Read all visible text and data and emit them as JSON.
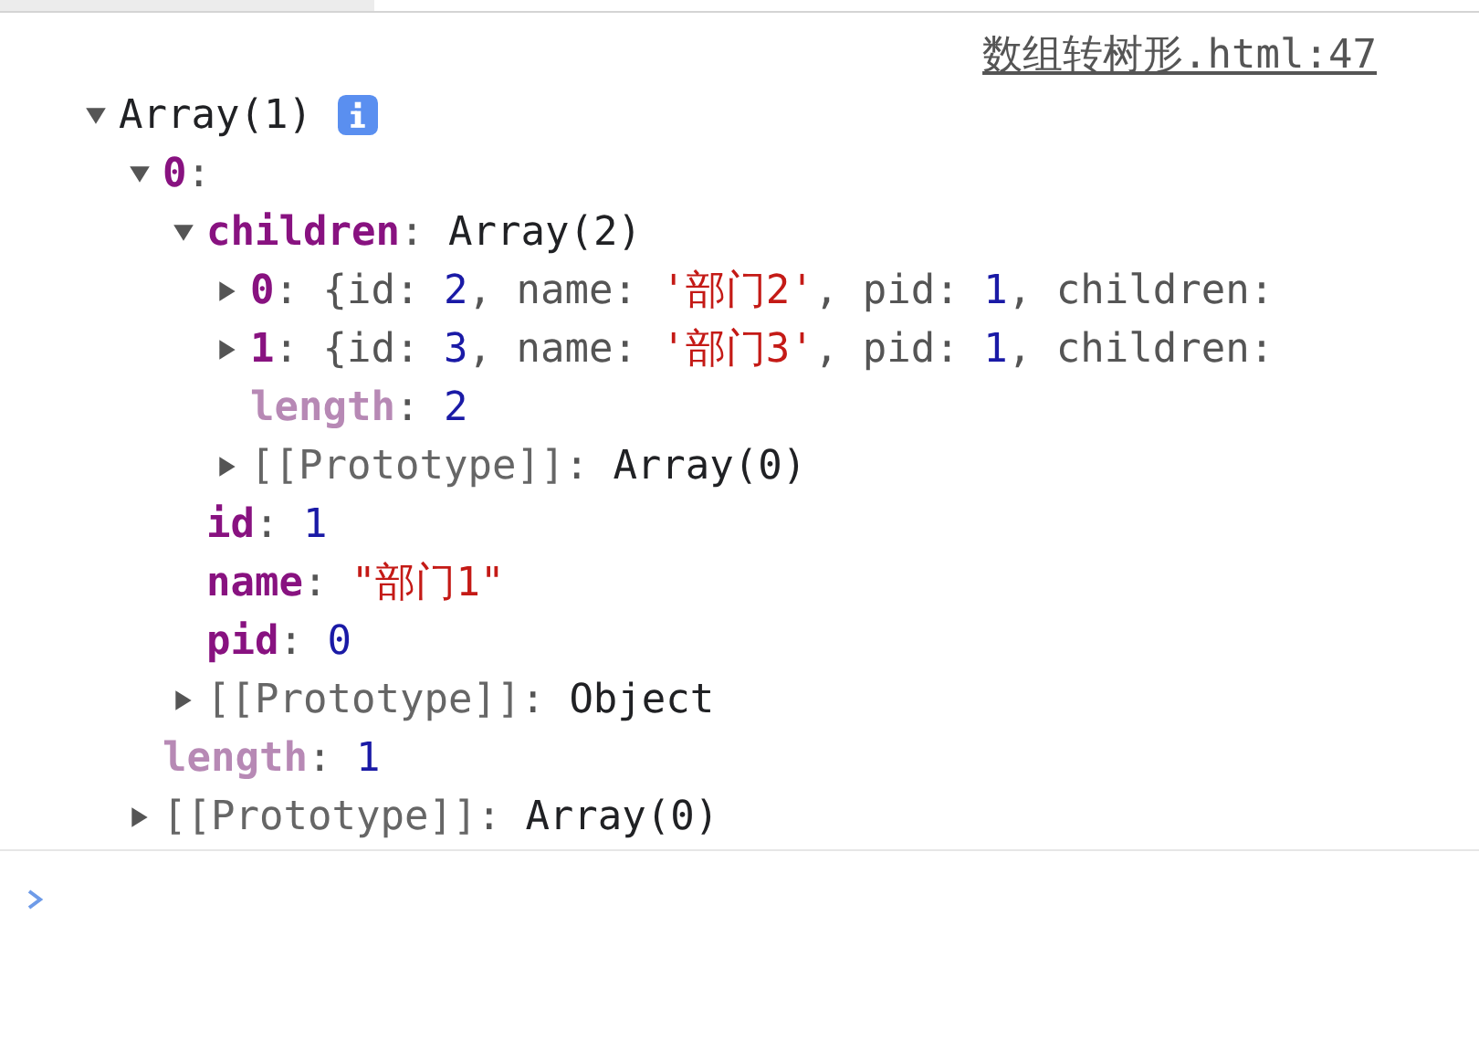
{
  "source_link": "数组转树形.html:47",
  "log": {
    "summary": "Array(1)",
    "info": true,
    "expanded": true,
    "children": [
      {
        "key": "0",
        "kind": "index",
        "value": [
          {
            "text": ":",
            "kind": "text"
          }
        ],
        "expanded": true,
        "children": [
          {
            "key": "children",
            "kind": "property",
            "value": [
              {
                "text": ": ",
                "kind": "text"
              },
              {
                "text": "Array(2)",
                "kind": "plain"
              }
            ],
            "expanded": true,
            "children": [
              {
                "key": "0",
                "kind": "index",
                "value": [
                  {
                    "text": ": {id: ",
                    "kind": "text"
                  },
                  {
                    "text": "2",
                    "kind": "number"
                  },
                  {
                    "text": ", name: ",
                    "kind": "text"
                  },
                  {
                    "text": "'部门2'",
                    "kind": "string"
                  },
                  {
                    "text": ", pid: ",
                    "kind": "text"
                  },
                  {
                    "text": "1",
                    "kind": "number"
                  },
                  {
                    "text": ", children:",
                    "kind": "text"
                  }
                ],
                "expanded": false
              },
              {
                "key": "1",
                "kind": "index",
                "value": [
                  {
                    "text": ": {id: ",
                    "kind": "text"
                  },
                  {
                    "text": "3",
                    "kind": "number"
                  },
                  {
                    "text": ", name: ",
                    "kind": "text"
                  },
                  {
                    "text": "'部门3'",
                    "kind": "string"
                  },
                  {
                    "text": ", pid: ",
                    "kind": "text"
                  },
                  {
                    "text": "1",
                    "kind": "number"
                  },
                  {
                    "text": ", children:",
                    "kind": "text"
                  }
                ],
                "expanded": false
              },
              {
                "key": "length",
                "kind": "meta",
                "value": [
                  {
                    "text": ": ",
                    "kind": "text"
                  },
                  {
                    "text": "2",
                    "kind": "number"
                  }
                ]
              },
              {
                "key": "[[Prototype]]",
                "kind": "internal",
                "value": [
                  {
                    "text": ": ",
                    "kind": "text"
                  },
                  {
                    "text": "Array(0)",
                    "kind": "plain"
                  }
                ],
                "expanded": false
              }
            ]
          },
          {
            "key": "id",
            "kind": "property",
            "value": [
              {
                "text": ": ",
                "kind": "text"
              },
              {
                "text": "1",
                "kind": "number"
              }
            ]
          },
          {
            "key": "name",
            "kind": "property",
            "value": [
              {
                "text": ": ",
                "kind": "text"
              },
              {
                "text": "\"部门1\"",
                "kind": "string"
              }
            ]
          },
          {
            "key": "pid",
            "kind": "property",
            "value": [
              {
                "text": ": ",
                "kind": "text"
              },
              {
                "text": "0",
                "kind": "number"
              }
            ]
          },
          {
            "key": "[[Prototype]]",
            "kind": "internal",
            "value": [
              {
                "text": ": ",
                "kind": "text"
              },
              {
                "text": "Object",
                "kind": "plain"
              }
            ],
            "expanded": false
          }
        ]
      },
      {
        "key": "length",
        "kind": "meta",
        "value": [
          {
            "text": ": ",
            "kind": "text"
          },
          {
            "text": "1",
            "kind": "number"
          }
        ]
      },
      {
        "key": "[[Prototype]]",
        "kind": "internal",
        "value": [
          {
            "text": ": ",
            "kind": "text"
          },
          {
            "text": "Array(0)",
            "kind": "plain"
          }
        ],
        "expanded": false
      }
    ]
  },
  "prompt": {
    "active": true
  }
}
